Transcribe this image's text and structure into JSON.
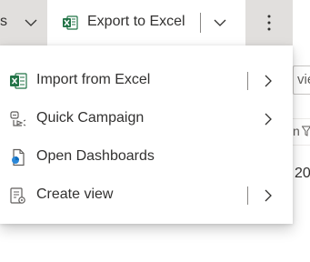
{
  "toolbar": {
    "prev_label_fragment": "s",
    "export_label": "Export to Excel",
    "icons": {
      "prev_dropdown": "chevron-down-icon",
      "export": "excel-icon",
      "export_dropdown": "chevron-down-icon",
      "more": "more-vertical-icon"
    }
  },
  "menu": {
    "items": [
      {
        "label": "Import from Excel",
        "icon": "excel-import-icon",
        "has_split": true
      },
      {
        "label": "Quick Campaign",
        "icon": "quick-campaign-icon",
        "has_split": false
      },
      {
        "label": "Open Dashboards",
        "icon": "dashboard-icon",
        "has_split": false
      },
      {
        "label": "Create view",
        "icon": "create-view-icon",
        "has_split": true
      }
    ]
  },
  "background": {
    "search_fragment": "vie",
    "column_fragment": "n",
    "cell_fragment": "20"
  },
  "colors": {
    "toolbar_pressed": "#e1dfdd",
    "excel_green": "#217346",
    "text": "#323130"
  }
}
